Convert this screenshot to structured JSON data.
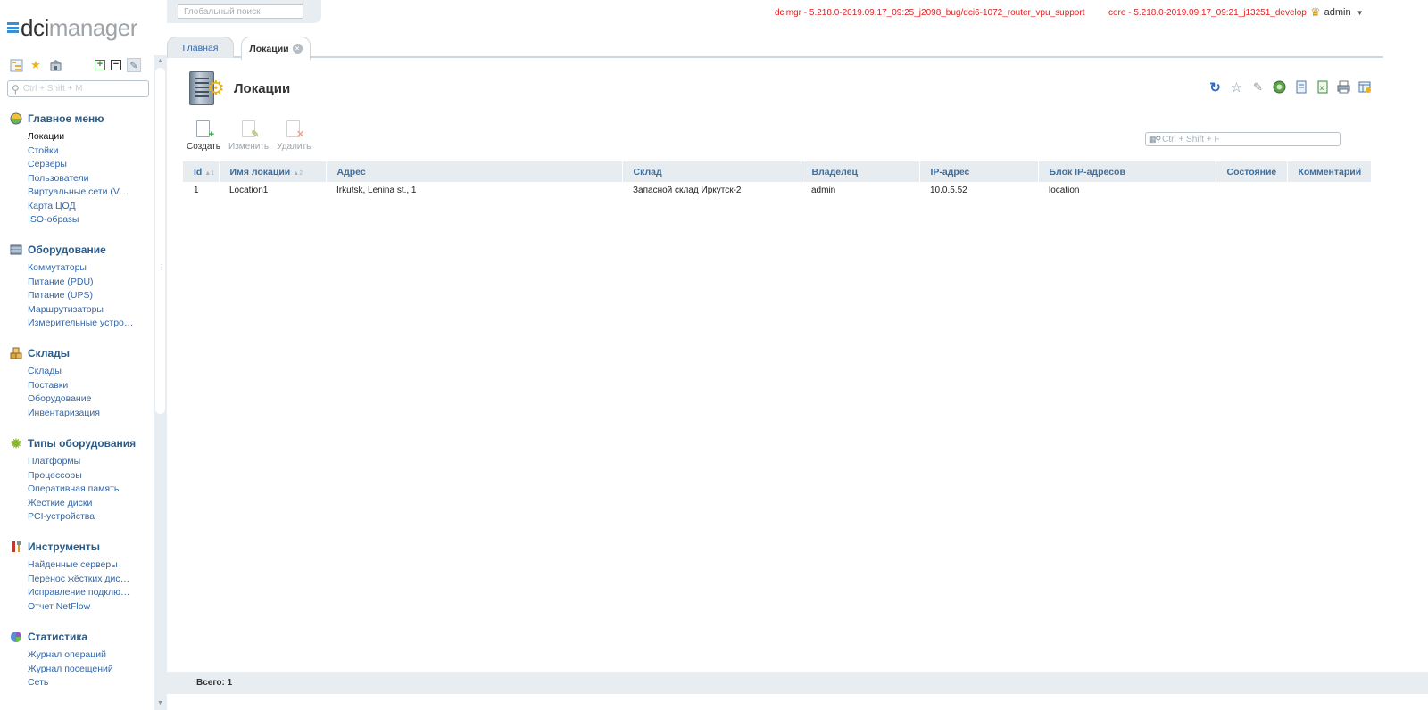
{
  "logo": {
    "dci": "dci",
    "mgr": "manager"
  },
  "global_search": {
    "placeholder": "Глобальный поиск"
  },
  "versions": {
    "dcimgr": "dcimgr - 5.218.0-2019.09.17_09:25_j2098_bug/dci6-1072_router_vpu_support",
    "core": "core - 5.218.0-2019.09.17_09:21_j13251_develop"
  },
  "user": {
    "name": "admin"
  },
  "menu_search": {
    "placeholder": "Ctrl + Shift + M"
  },
  "menu": [
    {
      "title": "Главное меню",
      "icon": "main-menu-icon",
      "items": [
        "Локации",
        "Стойки",
        "Серверы",
        "Пользователи",
        "Виртуальные сети (V…",
        "Карта ЦОД",
        "ISO-образы"
      ]
    },
    {
      "title": "Оборудование",
      "icon": "equipment-icon",
      "items": [
        "Коммутаторы",
        "Питание (PDU)",
        "Питание (UPS)",
        "Маршрутизаторы",
        "Измерительные устро…"
      ]
    },
    {
      "title": "Склады",
      "icon": "warehouse-icon",
      "items": [
        "Склады",
        "Поставки",
        "Оборудование",
        "Инвентаризация"
      ]
    },
    {
      "title": "Типы оборудования",
      "icon": "equipment-types-icon",
      "items": [
        "Платформы",
        "Процессоры",
        "Оперативная память",
        "Жесткие диски",
        "PCI-устройства"
      ]
    },
    {
      "title": "Инструменты",
      "icon": "tools-icon",
      "items": [
        "Найденные серверы",
        "Перенос жёстких дис…",
        "Исправление подклю…",
        "Отчет NetFlow"
      ]
    },
    {
      "title": "Статистика",
      "icon": "statistics-icon",
      "items": [
        "Журнал операций",
        "Журнал посещений",
        "Сеть"
      ]
    }
  ],
  "tabs": {
    "home": "Главная",
    "locations": "Локации"
  },
  "page": {
    "title": "Локации"
  },
  "actions": {
    "create": "Создать",
    "edit": "Изменить",
    "delete": "Удалить"
  },
  "filter": {
    "placeholder": "Ctrl + Shift + F"
  },
  "table": {
    "columns": [
      "Id",
      "Имя локации",
      "Адрес",
      "Склад",
      "Владелец",
      "IP-адрес",
      "Блок IP-адресов",
      "Состояние",
      "Комментарий"
    ],
    "sort_marks": {
      "id": "▲1",
      "name": "▲2"
    },
    "rows": [
      [
        "1",
        "Location1",
        "Irkutsk, Lenina st., 1",
        "Запасной склад Иркутск-2",
        "admin",
        "10.0.5.52",
        "location",
        "",
        ""
      ]
    ]
  },
  "footer": {
    "total": "Всего: 1"
  },
  "colors": {
    "accent": "#3467a6",
    "version_red": "#e32020",
    "panel": "#e8edf1"
  }
}
